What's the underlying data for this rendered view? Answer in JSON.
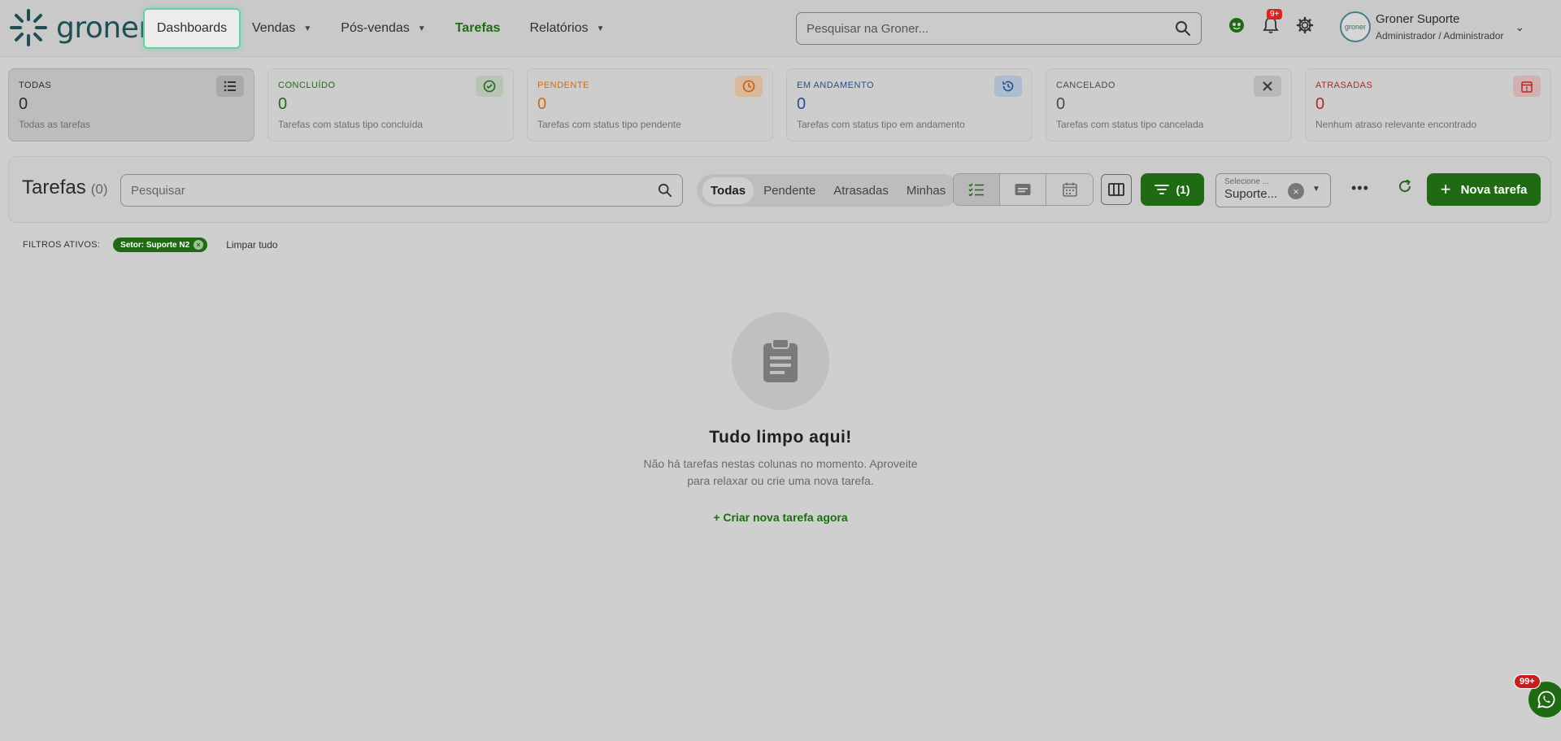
{
  "header": {
    "logo_text": "groner",
    "nav": [
      {
        "label": "Dashboards"
      },
      {
        "label": "Vendas"
      },
      {
        "label": "Pós-vendas"
      },
      {
        "label": "Tarefas"
      },
      {
        "label": "Relatórios"
      }
    ],
    "search_placeholder": "Pesquisar na Groner...",
    "notifications_badge": "9+",
    "user": {
      "name": "Groner Suporte",
      "role": "Administrador / Administrador",
      "avatar_text": "groner"
    }
  },
  "status_cards": [
    {
      "title": "TODAS",
      "count": "0",
      "desc": "Todas as tarefas",
      "color": "#2b2b2b",
      "icon": "list-icon"
    },
    {
      "title": "CONCLUÍDO",
      "count": "0",
      "desc": "Tarefas com status tipo concluída",
      "color": "#1e6b13",
      "icon": "check-circle-icon"
    },
    {
      "title": "PENDENTE",
      "count": "0",
      "desc": "Tarefas com status tipo pendente",
      "color": "#d06a10",
      "icon": "clock-icon"
    },
    {
      "title": "EM ANDAMENTO",
      "count": "0",
      "desc": "Tarefas com status tipo em andamento",
      "color": "#23508f",
      "icon": "progress-clock-icon"
    },
    {
      "title": "CANCELADO",
      "count": "0",
      "desc": "Tarefas com status tipo cancelada",
      "color": "#4a4a4a",
      "icon": "close-icon"
    },
    {
      "title": "ATRASADAS",
      "count": "0",
      "desc": "Nenhum atraso relevante encontrado",
      "color": "#b3262b",
      "icon": "calendar-alert-icon"
    }
  ],
  "toolbar": {
    "title": "Tarefas",
    "count": "(0)",
    "search_placeholder": "Pesquisar",
    "segments": [
      "Todas",
      "Pendente",
      "Atrasadas",
      "Minhas"
    ],
    "filter_count": "(1)",
    "select_label": "Selecione ...",
    "select_value": "Suporte...",
    "new_task_label": "Nova tarefa"
  },
  "active_filters": {
    "label": "FILTROS ATIVOS:",
    "chips": [
      "Setor: Suporte N2"
    ],
    "clear_all": "Limpar tudo"
  },
  "empty_state": {
    "title": "Tudo limpo aqui!",
    "desc_line1": "Não há tarefas nestas colunas no momento. Aproveite",
    "desc_line2": "para relaxar ou crie uma nova tarefa.",
    "cta": "+ Criar nova tarefa agora"
  },
  "whatsapp": {
    "badge": "99+"
  }
}
